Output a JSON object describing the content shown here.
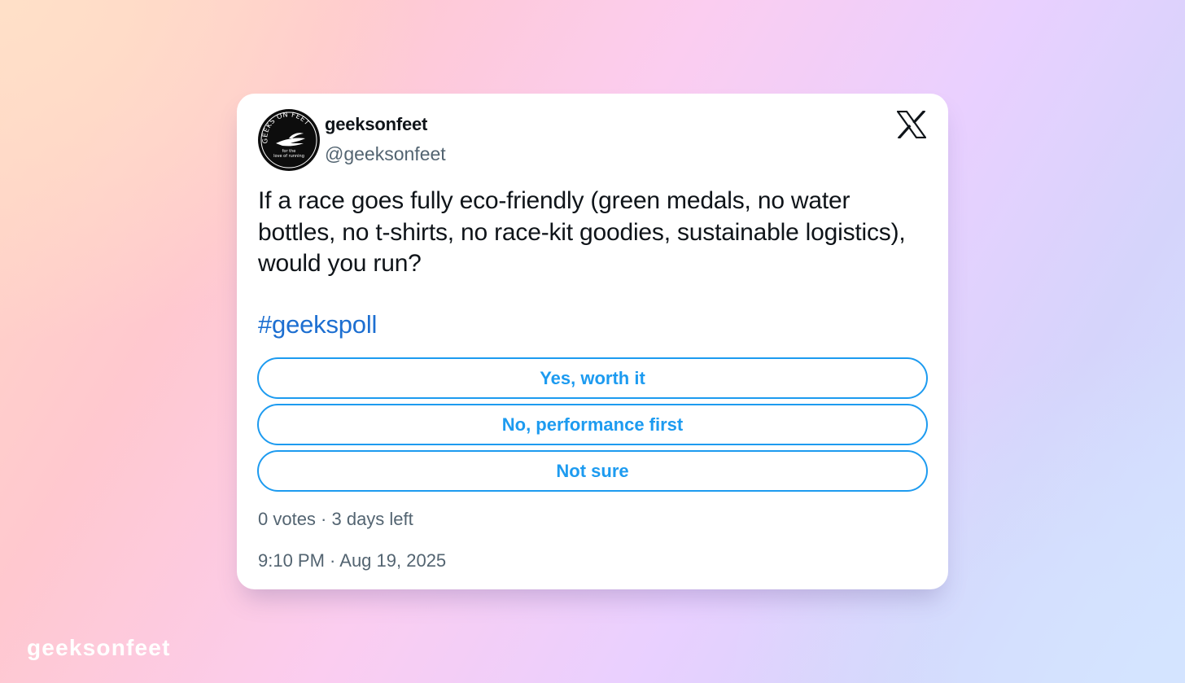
{
  "tweet": {
    "display_name": "geeksonfeet",
    "handle": "@geeksonfeet",
    "avatar": {
      "icon": "geeks-on-feet-logo",
      "logo_text_top": "GEEKS ON FEET",
      "logo_text_line1": "for the",
      "logo_text_line2": "love of running"
    },
    "platform_icon": "x-logo-icon",
    "text": "If a race goes fully eco-friendly (green medals, no water bottles, no t-shirts, no race-kit goodies, sustainable logistics), would you run?",
    "hashtag": "#geekspoll",
    "poll": {
      "options": [
        {
          "label": "Yes, worth it"
        },
        {
          "label": "No, performance first"
        },
        {
          "label": "Not sure"
        }
      ],
      "meta": "0 votes · 3 days left"
    },
    "timestamp": "9:10 PM · Aug 19, 2025"
  },
  "watermark": "geeksonfeet",
  "colors": {
    "accent": "#1d9bf0",
    "hashtag": "#1d6fd1",
    "text": "#0f1419",
    "muted": "#536471"
  }
}
